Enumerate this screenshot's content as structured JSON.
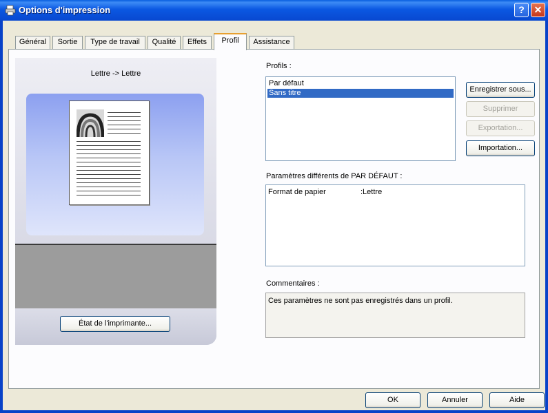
{
  "window": {
    "title": "Options d'impression",
    "help_button": "?",
    "close_button": "✕"
  },
  "tabs": [
    {
      "label": "Général",
      "active": false
    },
    {
      "label": "Sortie",
      "active": false
    },
    {
      "label": "Type de travail",
      "active": false
    },
    {
      "label": "Qualité",
      "active": false
    },
    {
      "label": "Effets",
      "active": false
    },
    {
      "label": "Profil",
      "active": true
    },
    {
      "label": "Assistance",
      "active": false
    }
  ],
  "preview": {
    "caption": "Lettre -> Lettre",
    "printer_status_button": "État de l'imprimante..."
  },
  "profiles": {
    "label": "Profils :",
    "items": [
      "Par défaut",
      "Sans titre"
    ],
    "selected": "Sans titre",
    "buttons": {
      "save_as": "Enregistrer sous...",
      "delete": "Supprimer",
      "export": "Exportation...",
      "import": "Importation..."
    }
  },
  "differences": {
    "label": "Paramètres différents de PAR DÉFAUT :",
    "rows": [
      {
        "name": "Format de papier",
        "value": ":Lettre"
      }
    ]
  },
  "comments": {
    "label": "Commentaires :",
    "text": "Ces paramètres ne sont pas enregistrés dans un profil."
  },
  "footer": {
    "ok": "OK",
    "cancel": "Annuler",
    "help": "Aide"
  },
  "colors": {
    "title_bar": "#0a5fe0",
    "selection": "#316ac5",
    "tab_highlight": "#e8a030"
  }
}
